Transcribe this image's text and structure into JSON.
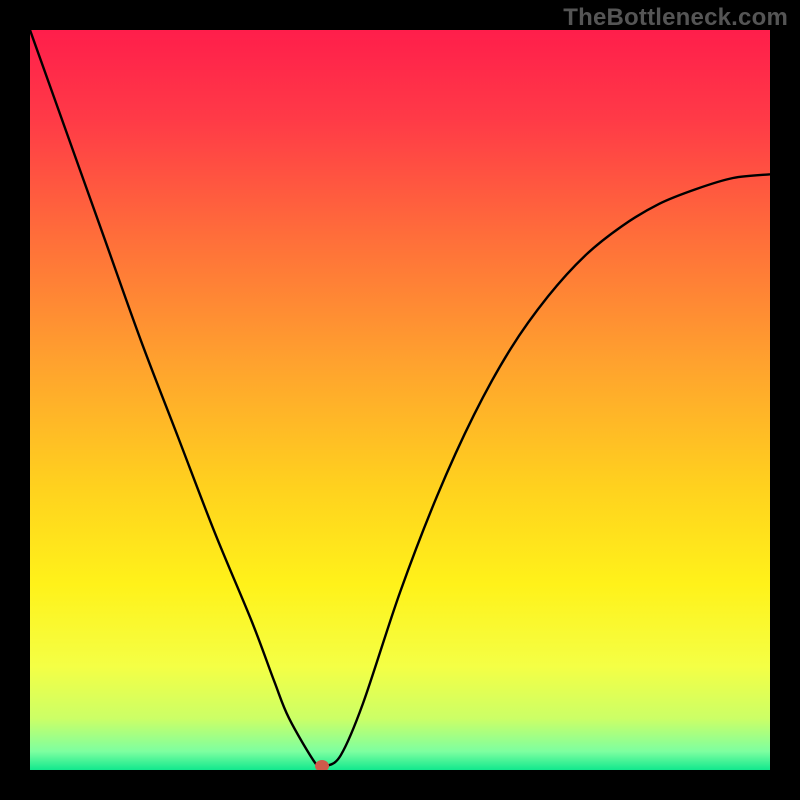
{
  "watermark": "TheBottleneck.com",
  "chart_data": {
    "type": "line",
    "title": "",
    "xlabel": "",
    "ylabel": "",
    "xlim": [
      0,
      100
    ],
    "ylim": [
      0,
      100
    ],
    "series": [
      {
        "name": "curve",
        "x": [
          0,
          5,
          10,
          15,
          20,
          25,
          30,
          33,
          35,
          38.5,
          39.5,
          40,
          42,
          45,
          50,
          55,
          60,
          65,
          70,
          75,
          80,
          85,
          90,
          95,
          100
        ],
        "values": [
          100,
          86,
          72,
          58,
          45,
          32,
          20,
          12,
          7,
          1,
          0.5,
          0.5,
          2,
          9,
          24,
          37,
          48,
          57,
          64,
          69.5,
          73.5,
          76.5,
          78.5,
          80,
          80.5
        ]
      }
    ],
    "marker": {
      "x": 39.5,
      "y": 0.5,
      "color": "#cf5a4b"
    },
    "gradient_stops": [
      {
        "offset": 0,
        "color": "#ff1e4b"
      },
      {
        "offset": 0.12,
        "color": "#ff3a47"
      },
      {
        "offset": 0.28,
        "color": "#ff6e3a"
      },
      {
        "offset": 0.45,
        "color": "#ffa22e"
      },
      {
        "offset": 0.62,
        "color": "#ffd21e"
      },
      {
        "offset": 0.75,
        "color": "#fff21a"
      },
      {
        "offset": 0.86,
        "color": "#f4ff45"
      },
      {
        "offset": 0.93,
        "color": "#ccff66"
      },
      {
        "offset": 0.975,
        "color": "#7dffa0"
      },
      {
        "offset": 1,
        "color": "#12e88e"
      }
    ],
    "curve_stroke": "#000000",
    "curve_width": 2.4
  }
}
